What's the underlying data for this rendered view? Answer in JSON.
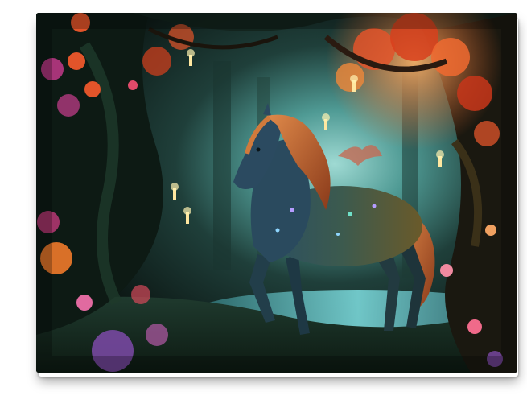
{
  "artwork": {
    "subject": "",
    "colors": {
      "forest_dark": "#0f1f1c",
      "forest_mid": "#1e3b34",
      "glow_teal": "#5fb7b0",
      "water": "#6fd2d6",
      "horse_body": "#2b4a55",
      "mane": "#c46a34",
      "foliage_orange": "#e24a22",
      "flower_pink": "#d8418f",
      "flower_purple": "#7c4aa8",
      "candle": "#ffe7a0"
    }
  }
}
